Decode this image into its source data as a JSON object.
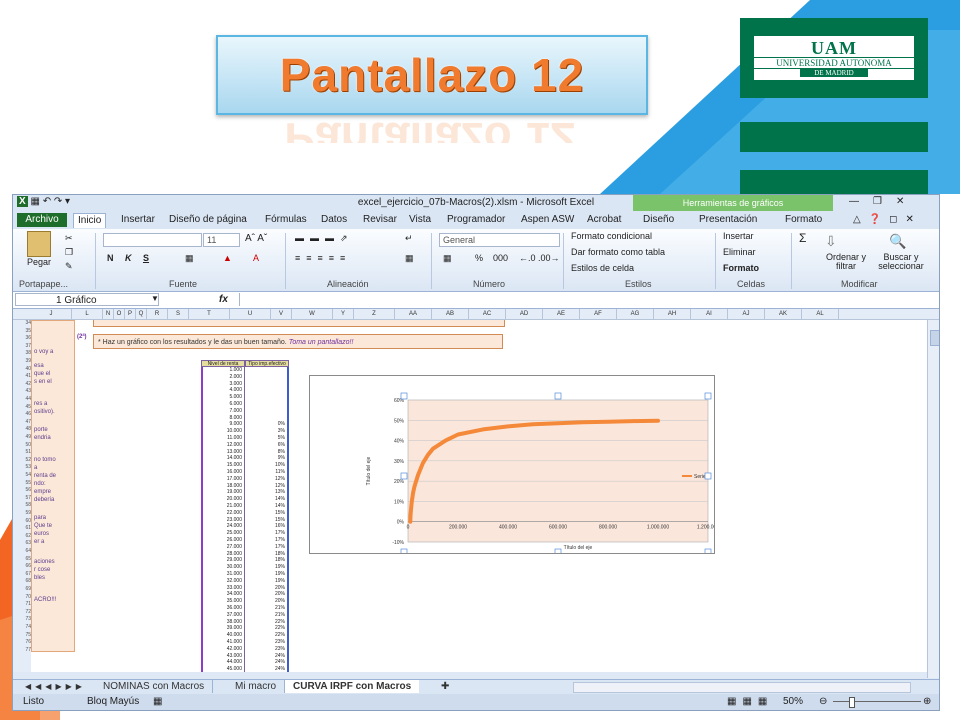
{
  "slide": {
    "title": "Pantallazo 12",
    "colors": {
      "title": "#f07a2e",
      "banner_border": "#5ab6e3",
      "logo_bg": "#00734a",
      "accent_blue": "#2a9ee0",
      "accent_orange": "#f26522"
    }
  },
  "logo": {
    "ua": "UAM",
    "name": "UNIVERSIDAD AUTONOMA",
    "sub": "DE MADRID"
  },
  "excel": {
    "window_title": "excel_ejercicio_07b-Macros(2).xlsm - Microsoft Excel",
    "context_tools": "Herramientas de gráficos",
    "tabs": [
      "Archivo",
      "Inicio",
      "Insertar",
      "Diseño de página",
      "Fórmulas",
      "Datos",
      "Revisar",
      "Vista",
      "Programador",
      "Aspen ASW",
      "Acrobat",
      "Diseño",
      "Presentación",
      "Formato"
    ],
    "ribbon": {
      "paste": "Pegar",
      "font_size": "11",
      "bold": "N",
      "italic": "K",
      "underline": "S",
      "number_format": "General",
      "percent": "%",
      "thousands": "000",
      "cond_format": "Formato condicional",
      "table_format": "Dar formato como tabla",
      "cell_styles": "Estilos de celda",
      "insert": "Insertar",
      "delete": "Eliminar",
      "format": "Formato",
      "sort": "Ordenar y filtrar",
      "find": "Buscar y seleccionar",
      "groups": [
        "Portapape...",
        "Fuente",
        "Alineación",
        "Número",
        "Estilos",
        "Celdas",
        "Modificar"
      ]
    },
    "name_box": "1 Gráfico",
    "fx": "fx",
    "columns": [
      "J",
      "L",
      "N",
      "O",
      "P",
      "Q",
      "R",
      "S",
      "T",
      "U",
      "V",
      "W",
      "Y",
      "Z",
      "AA",
      "AB",
      "AC",
      "AD",
      "AE",
      "AF",
      "AG",
      "AH",
      "AI",
      "AJ",
      "AK",
      "AL"
    ],
    "rows": [
      "34",
      "35",
      "36",
      "37",
      "38",
      "39",
      "40",
      "41",
      "42",
      "43",
      "44",
      "45",
      "46",
      "47",
      "48",
      "49",
      "50",
      "51",
      "52",
      "53",
      "54",
      "55",
      "56",
      "57",
      "58",
      "59",
      "60",
      "61",
      "62",
      "63",
      "64",
      "65",
      "66",
      "67",
      "68",
      "69",
      "70",
      "71",
      "72",
      "73",
      "74",
      "75",
      "76",
      "77"
    ],
    "left_panel_lines": [
      "o voy a",
      "esa",
      "que el",
      "s en el",
      "res a",
      "ositivo).",
      "porte",
      "endria",
      "no tomo",
      "a",
      "renta de",
      "ndo:",
      "empre",
      "debería",
      "para",
      "Que te",
      "euros",
      "er a",
      "aciones",
      "r cose",
      "bles",
      "ACRO!!!"
    ],
    "notes": [
      {
        "label": "(2ª)",
        "text": "* Haz un gráfico con los resultados y le das un buen tamaño.",
        "emph": "Toma un pantallazo!!"
      }
    ],
    "table": {
      "headers": [
        "Nivel de renta",
        "Tipo imp.efectivo"
      ],
      "col1": [
        "1.000",
        "2.000",
        "3.000",
        "4.000",
        "5.000",
        "6.000",
        "7.000",
        "8.000",
        "9.000",
        "10.000",
        "11.000",
        "12.000",
        "13.000",
        "14.000",
        "15.000",
        "16.000",
        "17.000",
        "18.000",
        "19.000",
        "20.000",
        "21.000",
        "22.000",
        "23.000",
        "24.000",
        "25.000",
        "26.000",
        "27.000",
        "28.000",
        "29.000",
        "30.000",
        "31.000",
        "32.000",
        "33.000",
        "34.000",
        "35.000",
        "36.000",
        "37.000",
        "38.000",
        "39.000",
        "40.000",
        "41.000",
        "42.000",
        "43.000",
        "44.000",
        "45.000"
      ],
      "col2": [
        "",
        "",
        "",
        "",
        "",
        "",
        "",
        "",
        "0%",
        "3%",
        "5%",
        "6%",
        "8%",
        "9%",
        "10%",
        "11%",
        "12%",
        "12%",
        "13%",
        "14%",
        "14%",
        "15%",
        "15%",
        "16%",
        "17%",
        "17%",
        "17%",
        "18%",
        "18%",
        "19%",
        "19%",
        "19%",
        "20%",
        "20%",
        "20%",
        "21%",
        "21%",
        "22%",
        "22%",
        "22%",
        "23%",
        "23%",
        "24%",
        "24%",
        "24%"
      ]
    },
    "sheet_tabs": [
      "NOMINAS con Macros",
      "Mi macro",
      "CURVA IRPF con Macros"
    ],
    "status": {
      "ready": "Listo",
      "caps": "Bloq Mayús",
      "zoom": "50%"
    }
  },
  "chart_data": {
    "type": "line",
    "title": "",
    "xlabel": "Título del eje",
    "ylabel": "Título del eje",
    "xlim": [
      0,
      1200000
    ],
    "ylim": [
      -0.1,
      0.6
    ],
    "x_ticks": [
      "0",
      "200.000",
      "400.000",
      "600.000",
      "800.000",
      "1.000.000",
      "1.200.000"
    ],
    "y_ticks": [
      "-10%",
      "0%",
      "10%",
      "20%",
      "30%",
      "40%",
      "50%",
      "60%"
    ],
    "series": [
      {
        "name": "Serie1",
        "color": "#f5893a",
        "x": [
          9000,
          10000,
          12000,
          15000,
          20000,
          25000,
          30000,
          40000,
          50000,
          60000,
          80000,
          100000,
          150000,
          200000,
          300000,
          400000,
          500000,
          600000,
          700000,
          800000,
          900000,
          1000000
        ],
        "y": [
          0.0,
          0.03,
          0.06,
          0.1,
          0.14,
          0.17,
          0.19,
          0.23,
          0.26,
          0.29,
          0.33,
          0.36,
          0.4,
          0.43,
          0.455,
          0.47,
          0.48,
          0.485,
          0.49,
          0.493,
          0.496,
          0.498
        ]
      }
    ],
    "legend": "right",
    "grid": true
  }
}
